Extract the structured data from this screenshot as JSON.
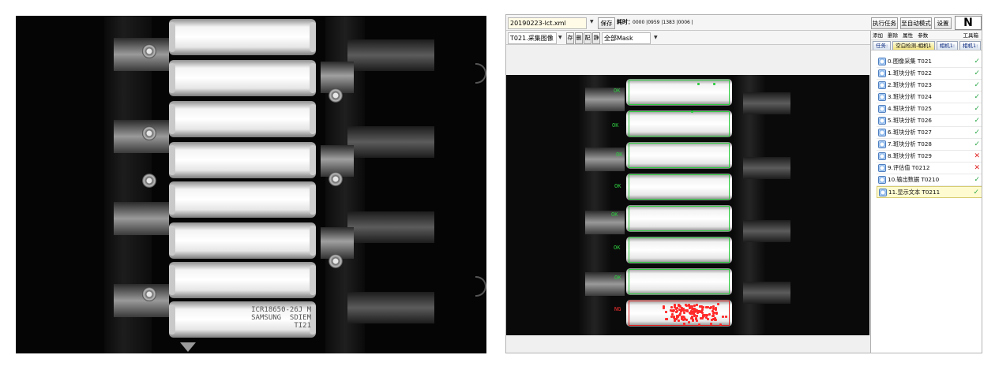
{
  "colors": {
    "ok_green": "#2ecc40",
    "fail_red": "#e02020",
    "selection": "#fffbd0",
    "active_tab": "#f2e27a"
  },
  "raw_image": {
    "print_line1": "ICR18650-26J M",
    "print_line2": "SAMSUNG  SDIEM",
    "print_line3": "TI21"
  },
  "toolbar1": {
    "project_combo": "20190223-lct.xml",
    "save_label": "保存",
    "timing_label": "耗时：",
    "timing_values": "0000 |0959 |1383 |0006 |",
    "run_task_label": "执行任务",
    "auto_mode_label": "至自动模式",
    "settings_label": "设置",
    "n_label": "N"
  },
  "toolbar2": {
    "image_combo": "T021.采集图像",
    "btn_store": "存",
    "btn_delete": "删",
    "btn_config": "配",
    "btn_static": "静",
    "mask_combo": "全部Mask"
  },
  "task_panel": {
    "menu": [
      "添加",
      "删除",
      "属性",
      "参数"
    ],
    "toolbox": "工具箱",
    "tabs": [
      "任务:",
      "空白检测-相机1",
      "相机1:",
      "相机1:"
    ],
    "items": [
      {
        "label": "0.图像采集 T021",
        "status": "ok"
      },
      {
        "label": "1.斑块分析 T022",
        "status": "ok"
      },
      {
        "label": "2.斑块分析 T023",
        "status": "ok"
      },
      {
        "label": "3.斑块分析 T024",
        "status": "ok"
      },
      {
        "label": "4.斑块分析 T025",
        "status": "ok"
      },
      {
        "label": "5.斑块分析 T026",
        "status": "ok"
      },
      {
        "label": "6.斑块分析 T027",
        "status": "ok"
      },
      {
        "label": "7.斑块分析 T028",
        "status": "ok"
      },
      {
        "label": "8.斑块分析 T029",
        "status": "fail"
      },
      {
        "label": "9.评估值 T0212",
        "status": "fail"
      },
      {
        "label": "10.输出数据 T0210",
        "status": "ok"
      },
      {
        "label": "11.显示文本 T0211",
        "status": "ok"
      }
    ]
  },
  "viewer": {
    "ok_text": "OK",
    "ng_text": "NG"
  }
}
